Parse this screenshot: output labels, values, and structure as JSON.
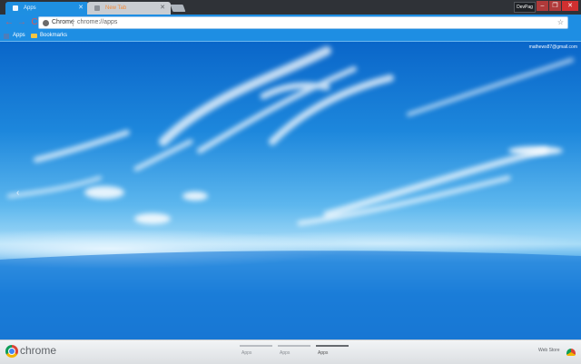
{
  "tabs": [
    {
      "label": "Apps",
      "active": true
    },
    {
      "label": "New Tab",
      "active": false
    }
  ],
  "window": {
    "profile_label": "DevPag",
    "min_glyph": "–",
    "max_glyph": "❐",
    "close_glyph": "✕"
  },
  "toolbar": {
    "chip_label": "Chrome",
    "url": "chrome://apps",
    "star_glyph": "☆",
    "back_glyph": "←",
    "forward_glyph": "→",
    "reload_glyph": "C"
  },
  "bookmarks": [
    {
      "label": "Apps"
    },
    {
      "label": "Bookmarks"
    }
  ],
  "content": {
    "account_email": "mathews87@gmail.com",
    "prev_glyph": "‹"
  },
  "bottombar": {
    "brand": "chrome",
    "page_tabs": [
      {
        "label": "Apps",
        "active": false
      },
      {
        "label": "Apps",
        "active": false
      },
      {
        "label": "Apps",
        "active": true
      }
    ],
    "webstore_label": "Web Store"
  },
  "colors": {
    "tab_active": "#1e8fe1",
    "toolbar": "#1e8ee3",
    "sky_top": "#0a66c9",
    "sky_bottom": "#1370cc",
    "tab_new_text": "#f08a3a"
  }
}
